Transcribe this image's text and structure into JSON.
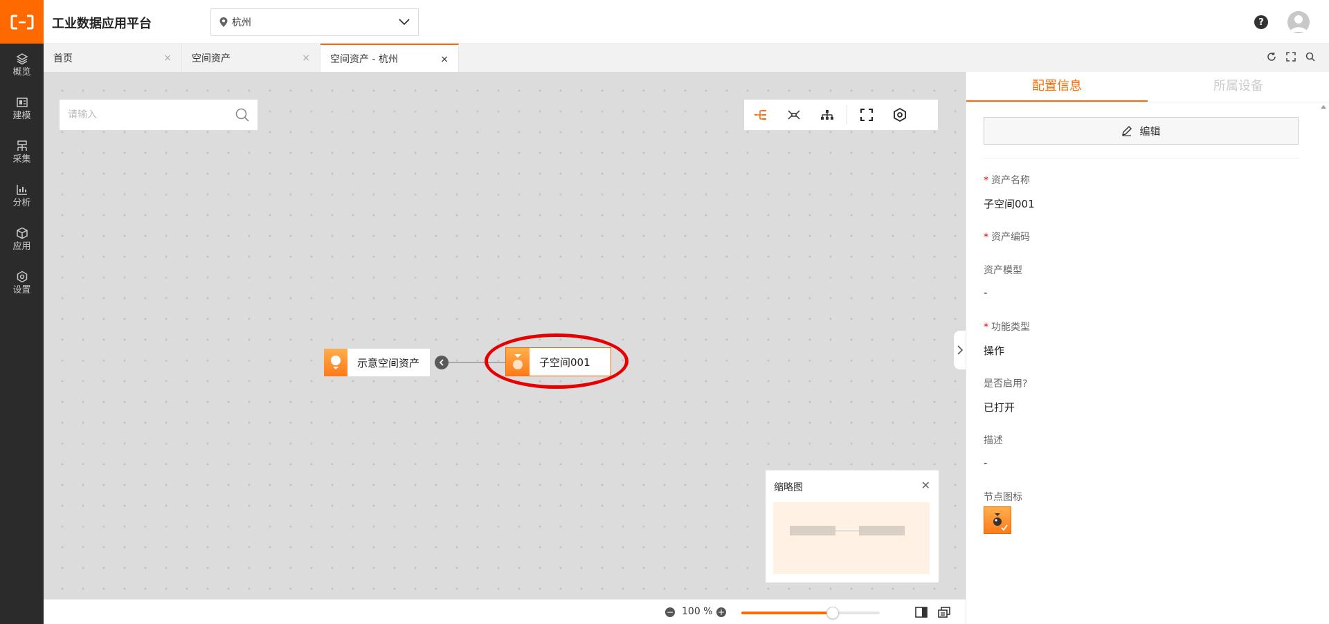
{
  "header": {
    "title": "工业数据应用平台",
    "location": "杭州"
  },
  "sidebar": {
    "items": [
      {
        "label": "概览",
        "icon": "layers-icon"
      },
      {
        "label": "建模",
        "icon": "model-icon"
      },
      {
        "label": "采集",
        "icon": "collect-icon"
      },
      {
        "label": "分析",
        "icon": "analysis-icon"
      },
      {
        "label": "应用",
        "icon": "cube-icon"
      },
      {
        "label": "设置",
        "icon": "settings-icon"
      }
    ]
  },
  "tabs": [
    {
      "label": "首页",
      "active": false
    },
    {
      "label": "空间资产",
      "active": false
    },
    {
      "label": "空间资产 - 杭州",
      "active": true
    }
  ],
  "canvas": {
    "search_placeholder": "请输入",
    "nodes": {
      "parent": "示意空间资产",
      "child": "子空间001"
    },
    "minimap_title": "缩略图",
    "zoom_value": "100 %",
    "zoom_level": 0.66
  },
  "panel": {
    "tabs": [
      "配置信息",
      "所属设备"
    ],
    "edit_label": "编辑",
    "fields": [
      {
        "label": "资产名称",
        "required": true,
        "value": "子空间001"
      },
      {
        "label": "资产编码",
        "required": true,
        "value": ""
      },
      {
        "label": "资产模型",
        "required": false,
        "value": "-"
      },
      {
        "label": "功能类型",
        "required": true,
        "value": "操作"
      },
      {
        "label": "是否启用?",
        "required": false,
        "value": "已打开"
      },
      {
        "label": "描述",
        "required": false,
        "value": "-"
      }
    ],
    "node_icon_label": "节点图标"
  },
  "colors": {
    "accent": "#ff6a00",
    "sidebar_bg": "#2b2b2b",
    "highlight": "#e60000"
  }
}
